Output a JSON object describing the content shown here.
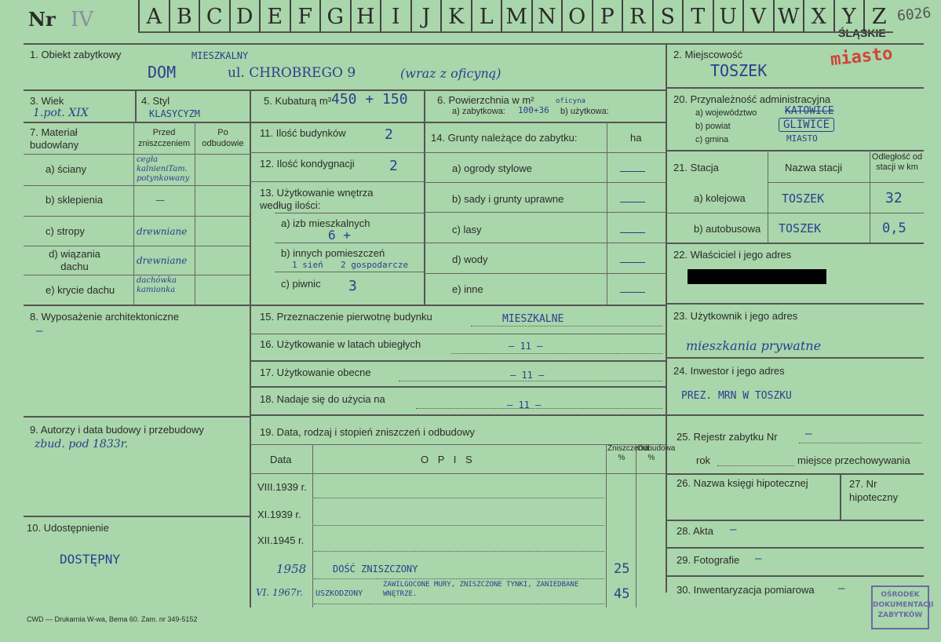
{
  "header": {
    "nr_label": "Nr",
    "nr_value": "IV",
    "letters": [
      "A",
      "B",
      "C",
      "D",
      "E",
      "F",
      "G",
      "H",
      "I",
      "J",
      "K",
      "L",
      "M",
      "N",
      "O",
      "P",
      "R",
      "S",
      "T",
      "U",
      "V",
      "W",
      "X",
      "Y",
      "Z"
    ],
    "corner_number": "6026",
    "region": "ŚLĄSKIE",
    "region_note": "miasto"
  },
  "f1": {
    "label": "1. Obiekt zabytkowy",
    "main": "DOM",
    "above": "MIESZKALNY",
    "street": "ul. CHROBREGO 9",
    "extra": "(wraz z oficyną)"
  },
  "f2": {
    "label": "2. Miejscowość",
    "value": "TOSZEK"
  },
  "f3": {
    "label": "3. Wiek",
    "value": "1.pot. XIX"
  },
  "f4": {
    "label": "4. Styl",
    "value": "KLASYCYZM"
  },
  "f5": {
    "label": "5. Kubaturą m³",
    "value": "450 + 150"
  },
  "f6": {
    "label": "6. Powierzchnia w m²",
    "a_label": "a) zabytkowa:",
    "a_value": "100+36",
    "above": "oficyna",
    "b_label": "b) użytkowa:"
  },
  "f20": {
    "label": "20. Przynależność administracyjna",
    "a_label": "a) województwo",
    "a_value": "KATOWICE",
    "b_label": "b) powiat",
    "b_value": "GLIWICE",
    "c_label": "c) gmina",
    "c_value": "MIASTO"
  },
  "f7": {
    "label": "7. Materiał budowlany",
    "col1": "Przed zniszczeniem",
    "col2": "Po odbudowie",
    "rows": [
      {
        "label": "a) ściany",
        "value": "cegła kalnieniTam. potynkowany"
      },
      {
        "label": "b) sklepienia",
        "value": "—"
      },
      {
        "label": "c) stropy",
        "value": "drewniane"
      },
      {
        "label": "d) wiązania dachu",
        "value": "drewniane"
      },
      {
        "label": "e) krycie dachu",
        "value": "dachówka kamionka"
      }
    ]
  },
  "f11": {
    "label": "11. Ilość budynków",
    "value": "2"
  },
  "f12": {
    "label": "12. Ilość kondygnacji",
    "value": "2"
  },
  "f13": {
    "label": "13. Użytkowanie wnętrza według ilości:",
    "a_label": "a) izb mieszkalnych",
    "a_value": "6 +",
    "b_label": "b) innych pomieszczeń",
    "b_value1": "1 sień",
    "b_value2": "2 gospodarcze",
    "c_label": "c) piwnic",
    "c_value": "3"
  },
  "f14": {
    "label": "14. Grunty należące do zabytku:",
    "unit": "ha",
    "rows": [
      "a) ogrody stylowe",
      "b) sady i grunty uprawne",
      "c) lasy",
      "d) wody",
      "e) inne"
    ]
  },
  "f21": {
    "label": "21. Stacja",
    "col1": "Nazwa stacji",
    "col2": "Odległość od stacji w km",
    "a_label": "a) kolejowa",
    "a_name": "TOSZEK",
    "a_km": "32",
    "b_label": "b) autobusowa",
    "b_name": "TOSZEK",
    "b_km": "0,5"
  },
  "f22": {
    "label": "22. Właściciel i jego adres"
  },
  "f8": {
    "label": "8. Wyposażenie architektoniczne",
    "value": "—"
  },
  "f15": {
    "label": "15. Przeznaczenie pierwotnę budynku",
    "value": "MIESZKALNE"
  },
  "f16": {
    "label": "16. Użytkowanie w latach ubiegłych",
    "value": "— 11 —"
  },
  "f17": {
    "label": "17. Użytkowanie obecne",
    "value": "— 11 —"
  },
  "f18": {
    "label": "18. Nadaje się do użycia na",
    "value": "— 11 —"
  },
  "f23": {
    "label": "23. Użytkownik i jego adres",
    "value": "mieszkania prywatne"
  },
  "f24": {
    "label": "24. Inwestor i jego adres",
    "value": "PREZ. MRN W TOSZKU"
  },
  "f9": {
    "label": "9. Autorzy i data budowy i przebudowy",
    "value": "zbud. pod 1833r."
  },
  "f19": {
    "label": "19. Data, rodzaj i stopień zniszczeń i odbudowy",
    "col_data": "Data",
    "col_opis": "O P I S",
    "col_zn": "Zniszczenia %",
    "col_odb": "Odbudowa %",
    "rows": [
      {
        "date": "VIII.1939 r.",
        "opis": "",
        "zn": ""
      },
      {
        "date": "XI.1939 r.",
        "opis": "",
        "zn": ""
      },
      {
        "date": "XII.1945 r.",
        "opis": "",
        "zn": ""
      },
      {
        "date": "1958",
        "opis": "DOŚĆ ZNISZCZONY",
        "zn": "25"
      },
      {
        "date": "VI. 1967r.",
        "opis": "USZKODZONY",
        "opis2": "ZAWILGOCONE MURY, ZNISZCZONE TYNKI, ZANIEDBANE WNĘTRZE.",
        "zn": "45"
      }
    ]
  },
  "f25": {
    "label": "25. Rejestr zabytku Nr",
    "value": "—",
    "rok_label": "rok",
    "miejsce_label": "miejsce przechowywania"
  },
  "f26": {
    "label": "26. Nazwa księgi hipotecznej"
  },
  "f27": {
    "label": "27. Nr hipoteczny"
  },
  "f28": {
    "label": "28. Akta",
    "value": "—"
  },
  "f29": {
    "label": "29. Fotografie",
    "value": "—"
  },
  "f30": {
    "label": "30. Inwentaryzacja pomiarowa",
    "value": "—"
  },
  "f10": {
    "label": "10. Udostępnienie",
    "value": "DOSTĘPNY"
  },
  "footer": {
    "printer": "CWD — Drukarnia W-wa, Bema 60. Zam. nr 349-5152"
  },
  "stamp": {
    "text": "OŚRODEK DOKUMENTACJI ZABYTKÓW"
  }
}
